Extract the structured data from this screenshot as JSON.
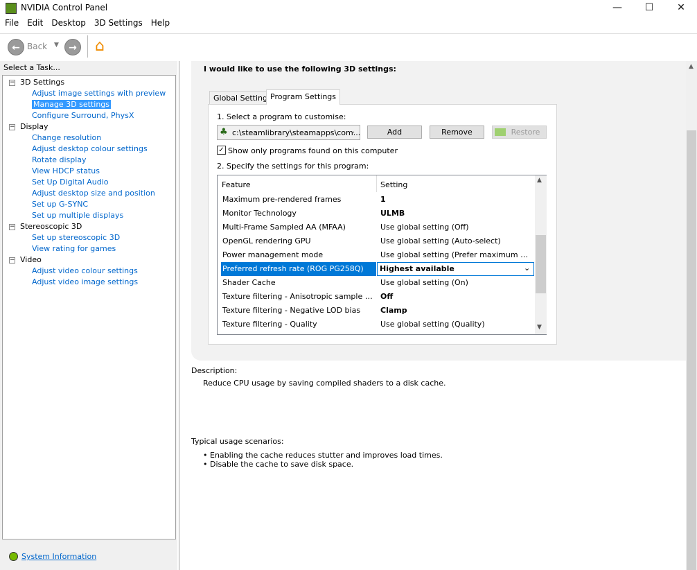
{
  "window": {
    "title": "NVIDIA Control Panel",
    "minimize": "—",
    "maximize": "☐",
    "close": "✕"
  },
  "menu": [
    "File",
    "Edit",
    "Desktop",
    "3D Settings",
    "Help"
  ],
  "toolbar": {
    "back": "Back"
  },
  "left": {
    "header": "Select a Task...",
    "system_info": "System Information",
    "tree": [
      {
        "label": "3D Settings",
        "items": [
          "Adjust image settings with preview",
          "Manage 3D settings",
          "Configure Surround, PhysX"
        ]
      },
      {
        "label": "Display",
        "items": [
          "Change resolution",
          "Adjust desktop colour settings",
          "Rotate display",
          "View HDCP status",
          "Set Up Digital Audio",
          "Adjust desktop size and position",
          "Set up G-SYNC",
          "Set up multiple displays"
        ]
      },
      {
        "label": "Stereoscopic 3D",
        "items": [
          "Set up stereoscopic 3D",
          "View rating for games"
        ]
      },
      {
        "label": "Video",
        "items": [
          "Adjust video colour settings",
          "Adjust video image settings"
        ]
      }
    ],
    "selected": "Manage 3D settings"
  },
  "main": {
    "heading": "I would like to use the following 3D settings:",
    "tabs": [
      "Global Settings",
      "Program Settings"
    ],
    "active_tab": "Program Settings",
    "step1": "1. Select a program to customise:",
    "program": "c:\\steamlibrary\\steamapps\\com...",
    "add": "Add",
    "remove": "Remove",
    "restore": "Restore",
    "show_only": "Show only programs found on this computer",
    "step2": "2. Specify the settings for this program:",
    "col_feature": "Feature",
    "col_setting": "Setting",
    "rows": [
      {
        "feature": "Maximum pre-rendered frames",
        "setting": "1",
        "bold": true
      },
      {
        "feature": "Monitor Technology",
        "setting": "ULMB",
        "bold": true
      },
      {
        "feature": "Multi-Frame Sampled AA (MFAA)",
        "setting": "Use global setting (Off)"
      },
      {
        "feature": "OpenGL rendering GPU",
        "setting": "Use global setting (Auto-select)"
      },
      {
        "feature": "Power management mode",
        "setting": "Use global setting (Prefer maximum performance)"
      },
      {
        "feature": "Preferred refresh rate (ROG PG258Q)",
        "setting": "Highest available",
        "selected": true
      },
      {
        "feature": "Shader Cache",
        "setting": "Use global setting (On)"
      },
      {
        "feature": "Texture filtering - Anisotropic sample optimization",
        "setting": "Off",
        "bold": true
      },
      {
        "feature": "Texture filtering - Negative LOD bias",
        "setting": "Clamp",
        "bold": true
      },
      {
        "feature": "Texture filtering - Quality",
        "setting": "Use global setting (Quality)"
      }
    ],
    "description_label": "Description:",
    "description": "Reduce CPU usage by saving compiled shaders to a disk cache.",
    "usage_label": "Typical usage scenarios:",
    "usage": [
      "Enabling the cache reduces stutter and improves load times.",
      "Disable the cache to save disk space."
    ]
  }
}
